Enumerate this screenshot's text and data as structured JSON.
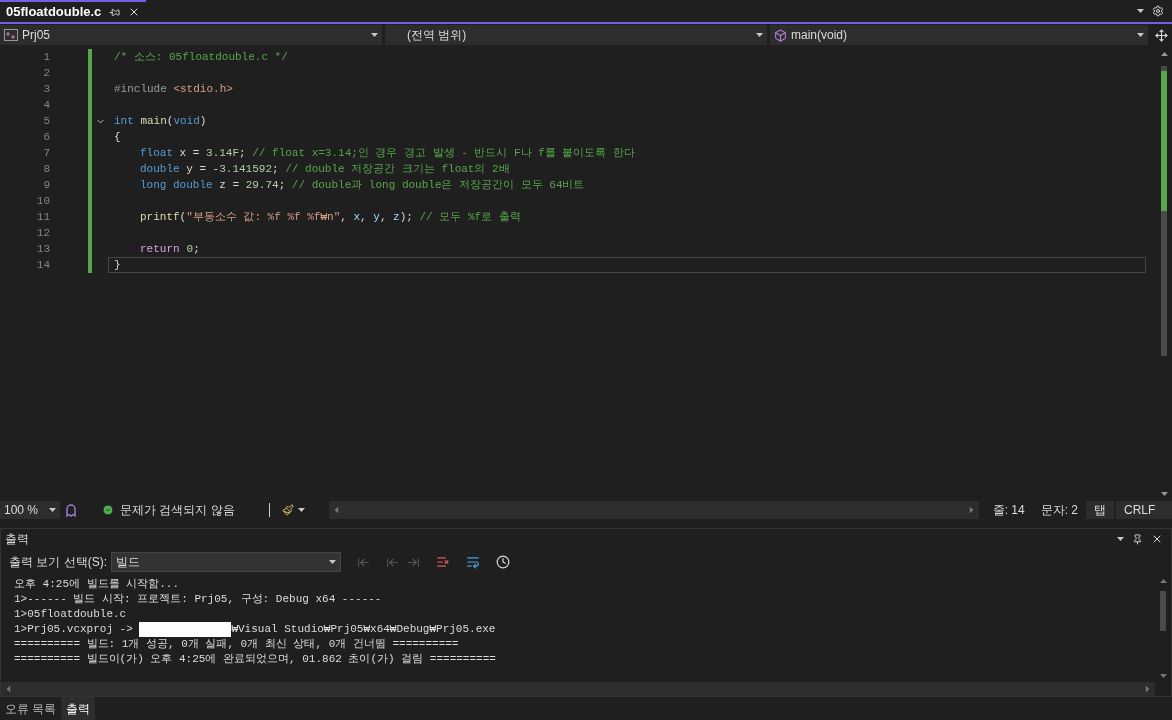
{
  "tabs": [
    {
      "label": "05floatdouble.c",
      "selected": true
    }
  ],
  "nav": {
    "project": "Prj05",
    "scope": "(전역 범위)",
    "member": "main(void)"
  },
  "editor": {
    "lines": [
      {
        "number": "1",
        "selected": false,
        "tokens": [
          {
            "kind": "comment",
            "text": "/* 소스: 05floatdouble.c */"
          }
        ]
      },
      {
        "number": "2",
        "selected": false
      },
      {
        "number": "3",
        "selected": false,
        "tokens": [
          {
            "kind": "preproc",
            "text": "#include "
          },
          {
            "kind": "string",
            "text": "<stdio.h>"
          }
        ]
      },
      {
        "number": "4",
        "selected": false
      },
      {
        "number": "5",
        "selected": false,
        "folding": {
          "expanded": true
        },
        "tokens": [
          {
            "kind": "keyword",
            "text": "int "
          },
          {
            "kind": "func",
            "text": "main"
          },
          {
            "kind": "plain",
            "text": "("
          },
          {
            "kind": "keyword",
            "text": "void"
          },
          {
            "kind": "plain",
            "text": ")"
          }
        ]
      },
      {
        "number": "6",
        "selected": false,
        "tokens": [
          {
            "kind": "plain",
            "text": "{"
          }
        ],
        "children": [
          {
            "number": "7",
            "selected": false,
            "tokens": [
              {
                "kind": "keyword",
                "text": "float"
              },
              {
                "kind": "plain",
                "text": " x = "
              },
              {
                "kind": "number",
                "text": "3.14F"
              },
              {
                "kind": "plain",
                "text": "; "
              },
              {
                "kind": "comment",
                "text": "// float x=3.14;인 경우 경고 발생 - 반드시 F나 f를 붙이도록 한다"
              }
            ]
          },
          {
            "number": "8",
            "selected": false,
            "tokens": [
              {
                "kind": "keyword",
                "text": "double"
              },
              {
                "kind": "plain",
                "text": " y = -"
              },
              {
                "kind": "number",
                "text": "3.141592"
              },
              {
                "kind": "plain",
                "text": "; "
              },
              {
                "kind": "comment",
                "text": "// double 저장공간 크기는 float의 2배"
              }
            ]
          },
          {
            "number": "9",
            "selected": false,
            "tokens": [
              {
                "kind": "keyword",
                "text": "long double"
              },
              {
                "kind": "plain",
                "text": " z = "
              },
              {
                "kind": "number",
                "text": "29.74"
              },
              {
                "kind": "plain",
                "text": "; "
              },
              {
                "kind": "comment",
                "text": "// double과 long double은 저장공간이 모두 64비트"
              }
            ]
          },
          {
            "number": "10",
            "selected": false
          },
          {
            "number": "11",
            "selected": false,
            "tokens": [
              {
                "kind": "func",
                "text": "printf"
              },
              {
                "kind": "plain",
                "text": "("
              },
              {
                "kind": "string",
                "text": "\"부동소수 값: %f %f %f₩n\""
              },
              {
                "kind": "plain",
                "text": ", "
              },
              {
                "kind": "variable",
                "text": "x"
              },
              {
                "kind": "plain",
                "text": ", "
              },
              {
                "kind": "variable",
                "text": "y"
              },
              {
                "kind": "plain",
                "text": ", "
              },
              {
                "kind": "variable",
                "text": "z"
              },
              {
                "kind": "plain",
                "text": "); "
              },
              {
                "kind": "comment",
                "text": "// 모두 %f로 출력"
              }
            ]
          },
          {
            "number": "12",
            "selected": false
          },
          {
            "number": "13",
            "selected": false,
            "tokens": [
              {
                "kind": "control",
                "text": "return"
              },
              {
                "kind": "number",
                "text": "0",
                "space_before": true
              },
              {
                "kind": "plain",
                "text": ";"
              }
            ]
          }
        ]
      },
      {
        "number": "14",
        "selected": true,
        "tokens": [
          {
            "kind": "plain",
            "text": "}"
          }
        ]
      }
    ]
  },
  "status": {
    "zoom": "100 %",
    "issues": "문제가 검색되지 않음",
    "line": "줄: 14",
    "char": "문자: 2",
    "indent": "탭",
    "eol": "CRLF"
  },
  "output": {
    "title": "출력",
    "source_label": "출력 보기 선택(S):",
    "source": "빌드",
    "lines": [
      [
        {
          "kind": "text",
          "text": "오후 4:25에 빌드를 시작함..."
        }
      ],
      [
        {
          "kind": "text",
          "text": "1>------ 빌드 시작: 프로젝트: Prj05, 구성: Debug x64 ------"
        }
      ],
      [
        {
          "kind": "text",
          "text": "1>05floatdouble.c"
        }
      ],
      [
        {
          "kind": "text",
          "text": "1>Prj05.vcxproj -> "
        },
        {
          "kind": "redacted"
        },
        {
          "kind": "text",
          "text": "₩Visual Studio₩Prj05₩x64₩Debug₩Prj05.exe"
        }
      ],
      [
        {
          "kind": "text",
          "text": "========== 빌드: 1개 성공, 0개 실패, 0개 최신 상태, 0개 건너뜀 =========="
        }
      ],
      [
        {
          "kind": "text",
          "text": "========== 빌드이(가) 오후 4:25에 완료되었으며, 01.862 초이(가) 걸림 =========="
        }
      ]
    ]
  },
  "bottom_tabs": [
    {
      "label": "오류 목록",
      "selected": false
    },
    {
      "label": "출력",
      "selected": true
    }
  ]
}
